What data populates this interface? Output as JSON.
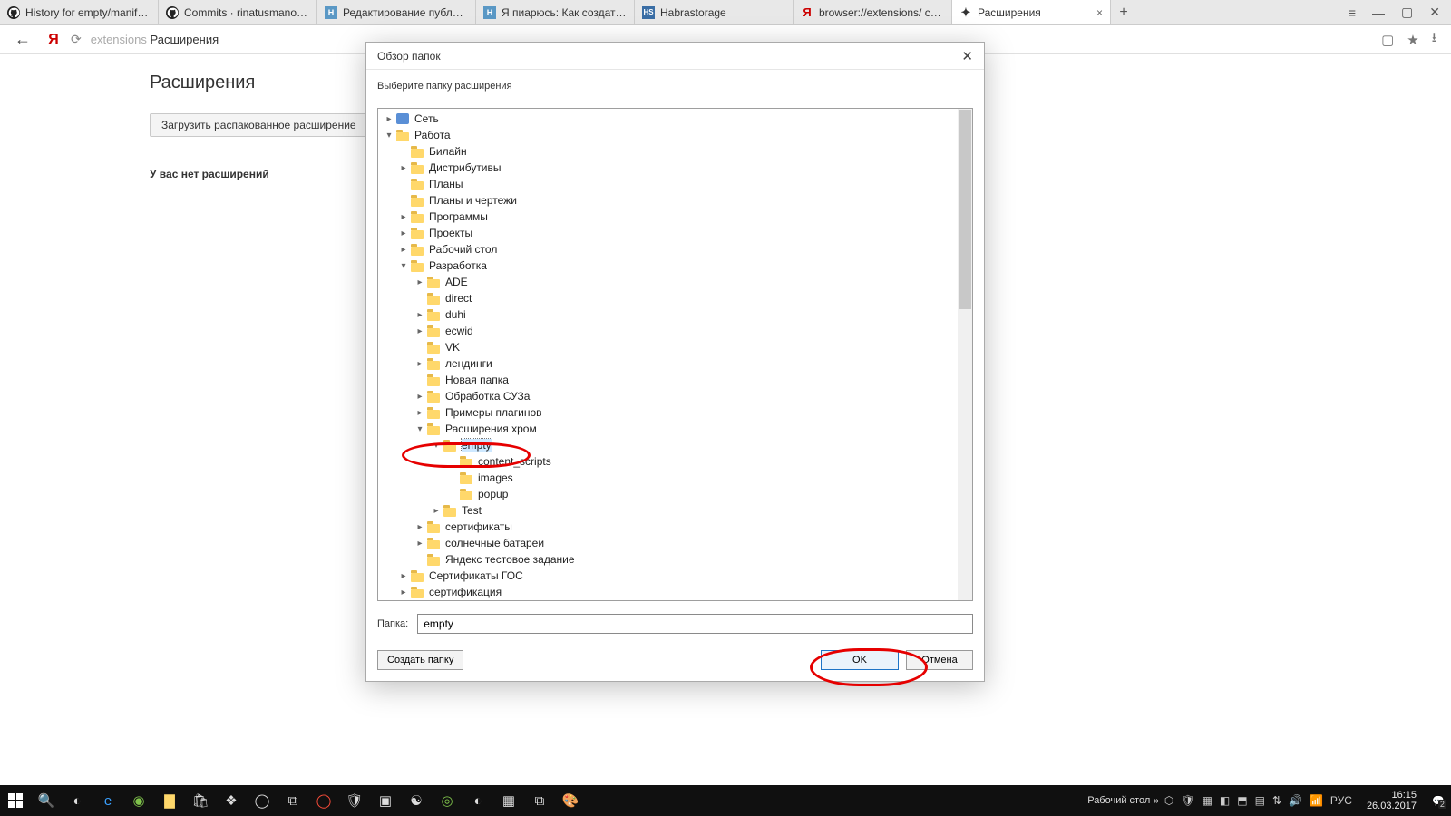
{
  "tabs": [
    {
      "icon": "gh",
      "label": "History for empty/manifest"
    },
    {
      "icon": "gh",
      "label": "Commits · rinatusmanov/e"
    },
    {
      "icon": "habr",
      "label": "Редактирование публика"
    },
    {
      "icon": "habr",
      "label": "Я пиарюсь: Как создать e"
    },
    {
      "icon": "hs",
      "label": "Habrastorage"
    },
    {
      "icon": "ya",
      "label": "browser://extensions/ ccak"
    },
    {
      "icon": "ext",
      "label": "Расширения",
      "active": true
    }
  ],
  "addr": {
    "hint": "extensions",
    "title": "Расширения"
  },
  "page": {
    "title": "Расширения",
    "load_btn": "Загрузить распакованное расширение",
    "no_ext": "У вас нет расширений"
  },
  "dialog": {
    "title": "Обзор папок",
    "instruction": "Выберите папку расширения",
    "folder_label": "Папка:",
    "folder_value": "empty",
    "make_folder": "Создать папку",
    "ok": "OK",
    "cancel": "Отмена",
    "tree": [
      {
        "depth": 1,
        "exp": "▸",
        "kind": "net",
        "label": "Сеть"
      },
      {
        "depth": 1,
        "exp": "▾",
        "kind": "folder",
        "label": "Работа"
      },
      {
        "depth": 2,
        "exp": "",
        "kind": "folder",
        "label": "Билайн"
      },
      {
        "depth": 2,
        "exp": "▸",
        "kind": "folder",
        "label": "Дистрибутивы"
      },
      {
        "depth": 2,
        "exp": "",
        "kind": "folder",
        "label": "Планы"
      },
      {
        "depth": 2,
        "exp": "",
        "kind": "folder",
        "label": "Планы и чертежи"
      },
      {
        "depth": 2,
        "exp": "▸",
        "kind": "folder",
        "label": "Программы"
      },
      {
        "depth": 2,
        "exp": "▸",
        "kind": "folder",
        "label": "Проекты"
      },
      {
        "depth": 2,
        "exp": "▸",
        "kind": "folder",
        "label": "Рабочий стол"
      },
      {
        "depth": 2,
        "exp": "▾",
        "kind": "folder",
        "label": "Разработка"
      },
      {
        "depth": 3,
        "exp": "▸",
        "kind": "folder",
        "label": "ADE"
      },
      {
        "depth": 3,
        "exp": "",
        "kind": "folder",
        "label": "direct"
      },
      {
        "depth": 3,
        "exp": "▸",
        "kind": "folder",
        "label": "duhi"
      },
      {
        "depth": 3,
        "exp": "▸",
        "kind": "folder",
        "label": "ecwid"
      },
      {
        "depth": 3,
        "exp": "",
        "kind": "folder",
        "label": "VK"
      },
      {
        "depth": 3,
        "exp": "▸",
        "kind": "folder",
        "label": "лендинги"
      },
      {
        "depth": 3,
        "exp": "",
        "kind": "folder",
        "label": "Новая папка"
      },
      {
        "depth": 3,
        "exp": "▸",
        "kind": "folder",
        "label": "Обработка СУЗа"
      },
      {
        "depth": 3,
        "exp": "▸",
        "kind": "folder",
        "label": "Примеры плагинов"
      },
      {
        "depth": 3,
        "exp": "▾",
        "kind": "folder",
        "label": "Расширения хром"
      },
      {
        "depth": 4,
        "exp": "▾",
        "kind": "folder",
        "label": "empty",
        "sel": true
      },
      {
        "depth": 5,
        "exp": "",
        "kind": "folder",
        "label": "content_scripts"
      },
      {
        "depth": 5,
        "exp": "",
        "kind": "folder",
        "label": "images"
      },
      {
        "depth": 5,
        "exp": "",
        "kind": "folder",
        "label": "popup"
      },
      {
        "depth": 4,
        "exp": "▸",
        "kind": "folder",
        "label": "Test"
      },
      {
        "depth": 3,
        "exp": "▸",
        "kind": "folder",
        "label": "сертификаты"
      },
      {
        "depth": 3,
        "exp": "▸",
        "kind": "folder",
        "label": "солнечные батареи"
      },
      {
        "depth": 3,
        "exp": "",
        "kind": "folder",
        "label": "Яндекс тестовое задание"
      },
      {
        "depth": 2,
        "exp": "▸",
        "kind": "folder",
        "label": "Сертификаты ГОС"
      },
      {
        "depth": 2,
        "exp": "▸",
        "kind": "folder",
        "label": "сертификация"
      }
    ]
  },
  "taskbar": {
    "desktop_label": "Рабочий стол",
    "lang": "РУС",
    "time": "16:15",
    "date": "26.03.2017",
    "notif_count": "2"
  }
}
